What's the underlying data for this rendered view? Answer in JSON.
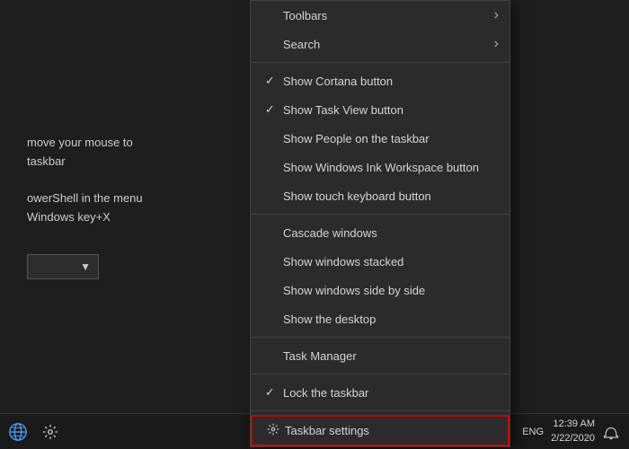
{
  "left": {
    "line1": "move your mouse to",
    "line2": "taskbar",
    "line3": "",
    "line4": "owerShell in the menu",
    "line5": "Windows key+X",
    "dropdown_label": "▼"
  },
  "menu": {
    "items": [
      {
        "id": "toolbars",
        "label": "Toolbars",
        "check": false,
        "arrow": true,
        "separator_after": false
      },
      {
        "id": "search",
        "label": "Search",
        "check": false,
        "arrow": true,
        "separator_after": true
      },
      {
        "id": "cortana",
        "label": "Show Cortana button",
        "check": true,
        "arrow": false,
        "separator_after": false
      },
      {
        "id": "taskview",
        "label": "Show Task View button",
        "check": true,
        "arrow": false,
        "separator_after": false
      },
      {
        "id": "people",
        "label": "Show People on the taskbar",
        "check": false,
        "arrow": false,
        "separator_after": false
      },
      {
        "id": "ink",
        "label": "Show Windows Ink Workspace button",
        "check": false,
        "arrow": false,
        "separator_after": false
      },
      {
        "id": "touch",
        "label": "Show touch keyboard button",
        "check": false,
        "arrow": false,
        "separator_after": true
      },
      {
        "id": "cascade",
        "label": "Cascade windows",
        "check": false,
        "arrow": false,
        "separator_after": false
      },
      {
        "id": "stacked",
        "label": "Show windows stacked",
        "check": false,
        "arrow": false,
        "separator_after": false
      },
      {
        "id": "sidebyside",
        "label": "Show windows side by side",
        "check": false,
        "arrow": false,
        "separator_after": false
      },
      {
        "id": "desktop",
        "label": "Show the desktop",
        "check": false,
        "arrow": false,
        "separator_after": true
      },
      {
        "id": "taskmanager",
        "label": "Task Manager",
        "check": false,
        "arrow": false,
        "separator_after": true
      },
      {
        "id": "lock",
        "label": "Lock the taskbar",
        "check": true,
        "arrow": false,
        "separator_after": true
      },
      {
        "id": "settings",
        "label": "Taskbar settings",
        "check": false,
        "arrow": false,
        "separator_after": false,
        "highlighted": true
      }
    ]
  },
  "taskbar": {
    "lang": "ENG",
    "time": "12:39 AM",
    "date": "2/22/2020"
  }
}
